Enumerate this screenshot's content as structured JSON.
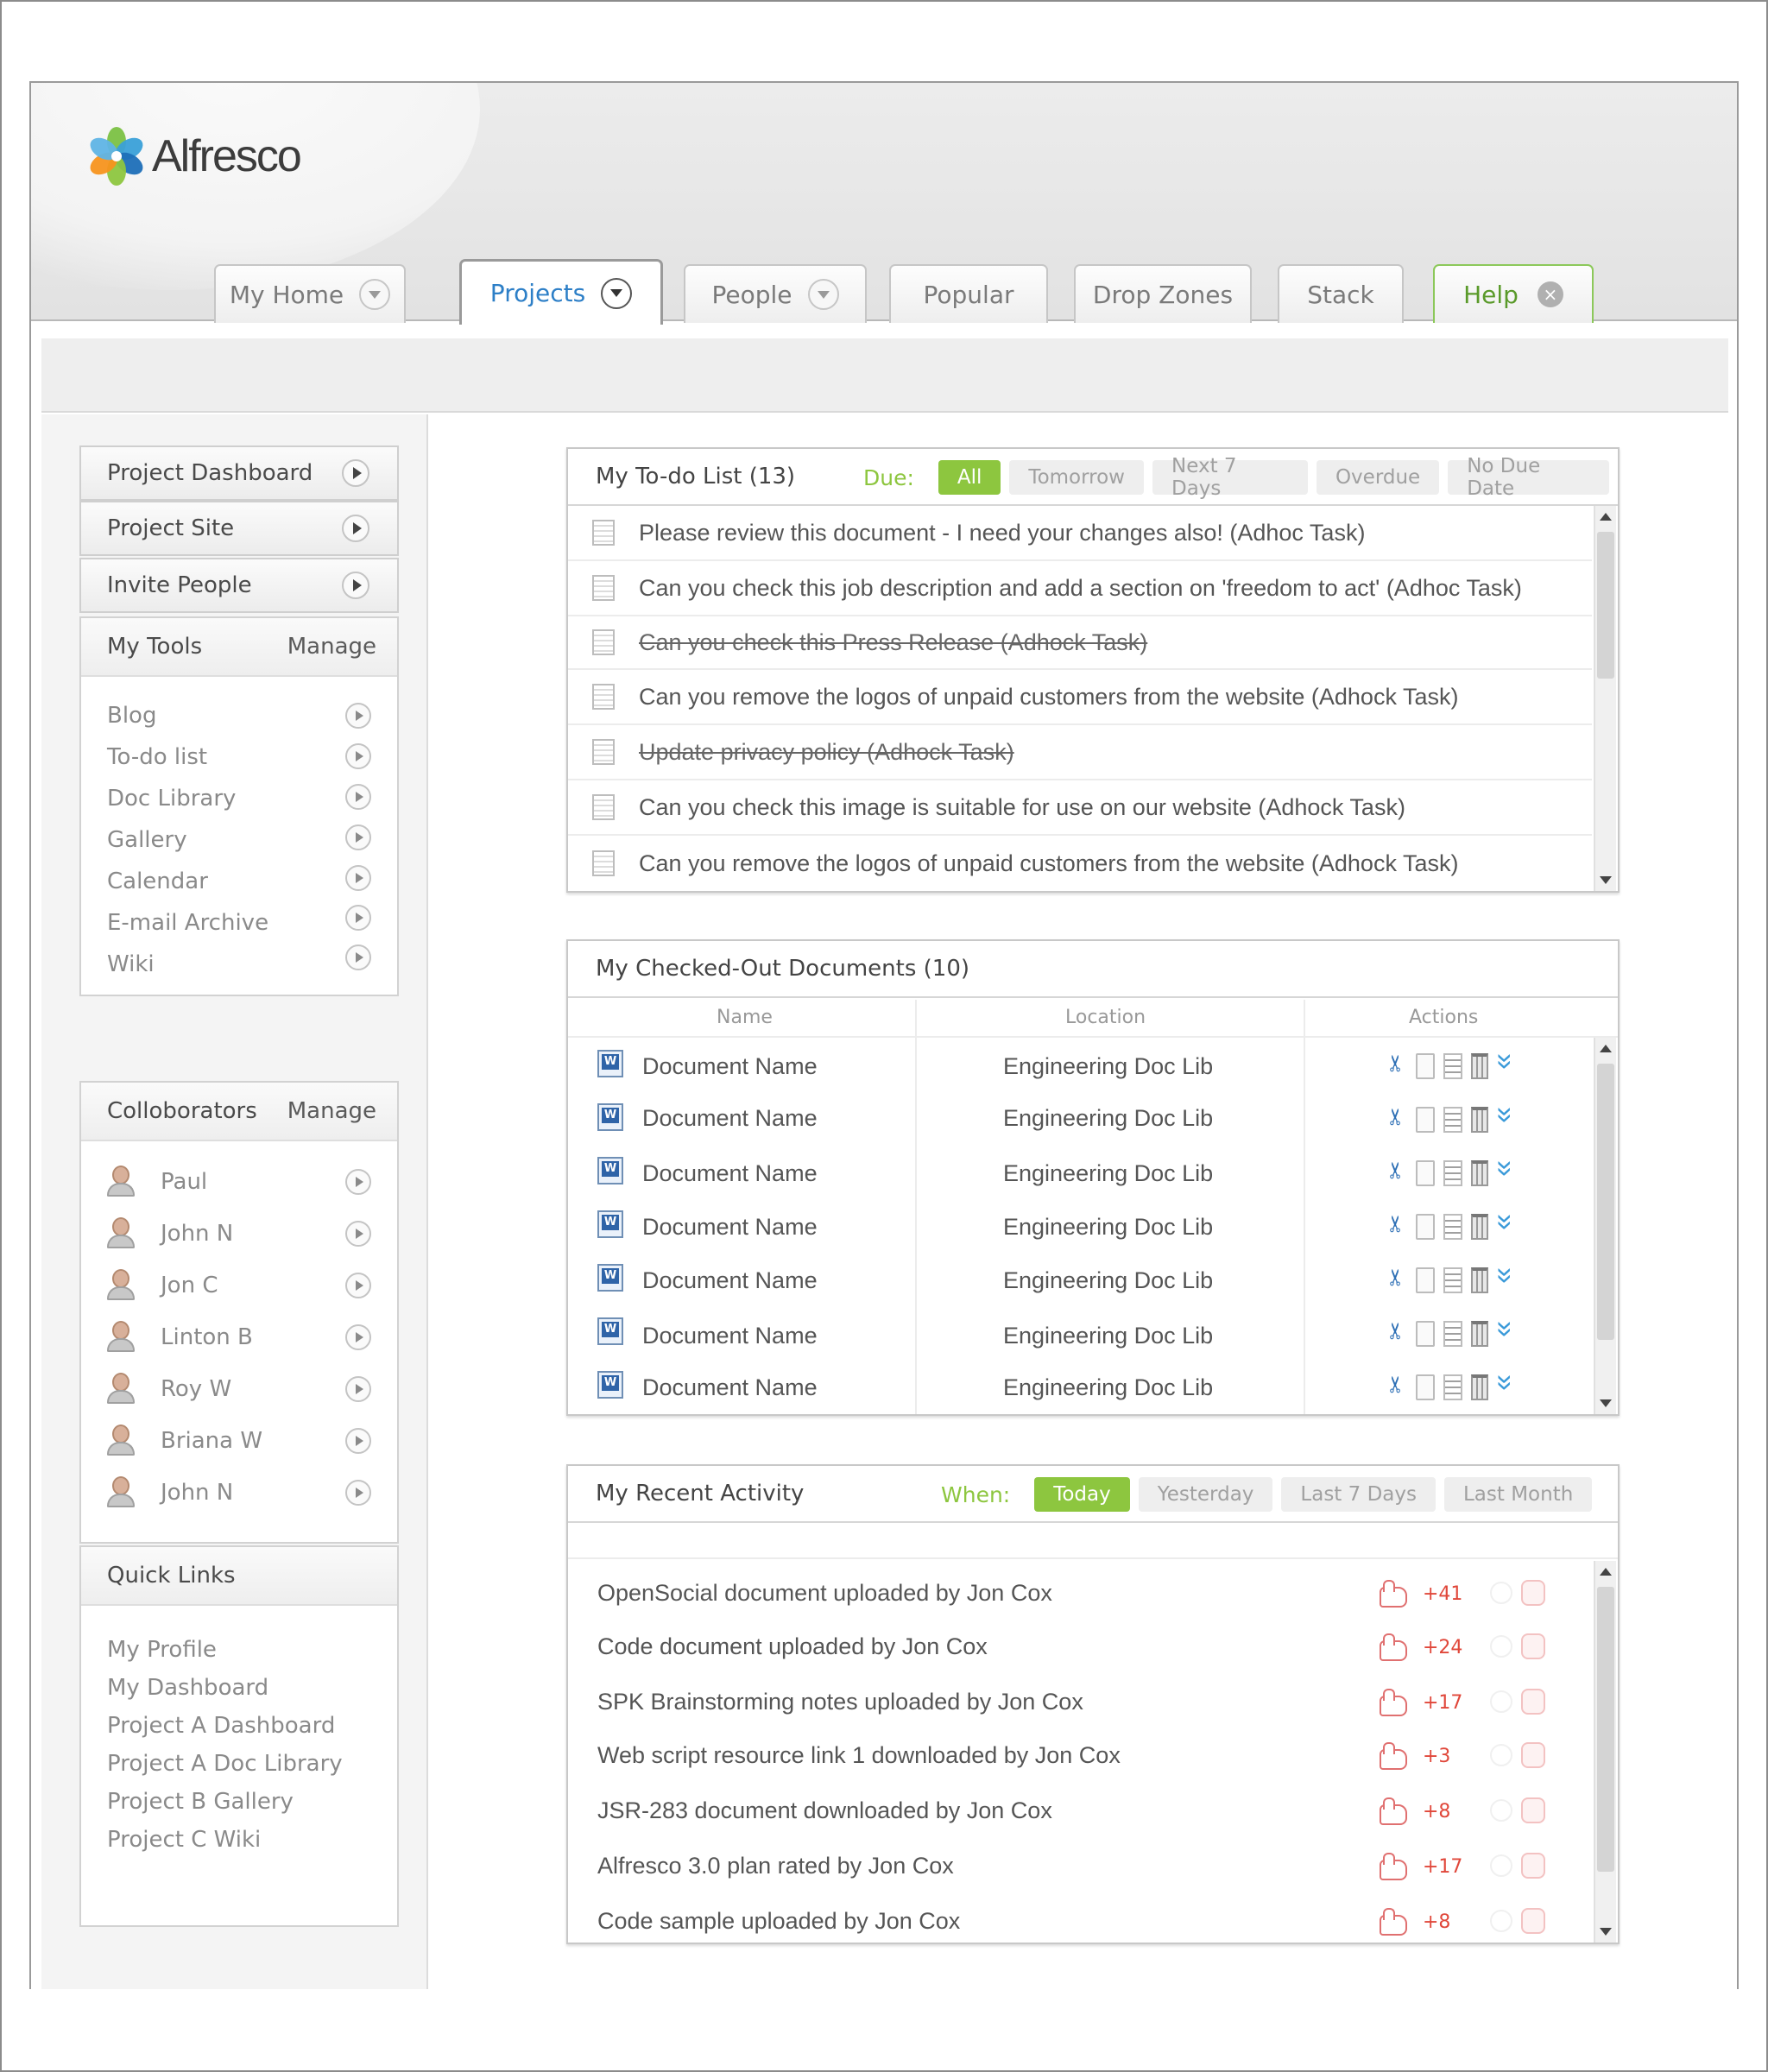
{
  "app": {
    "logo_text": "Alfresco"
  },
  "tabs": [
    {
      "label": "My Home",
      "has_dropdown": true
    },
    {
      "label": "Projects",
      "has_dropdown": true,
      "active": true
    },
    {
      "label": "People",
      "has_dropdown": true
    },
    {
      "label": "Popular"
    },
    {
      "label": "Drop Zones"
    },
    {
      "label": "Stack"
    },
    {
      "label": "Help",
      "has_close": true
    }
  ],
  "sidebar": {
    "nav": [
      {
        "label": "Project Dashboard"
      },
      {
        "label": "Project Site"
      },
      {
        "label": "Invite People"
      }
    ],
    "tools": {
      "title": "My Tools",
      "manage": "Manage",
      "items": [
        "Blog",
        "To-do list",
        "Doc Library",
        "Gallery",
        "Calendar",
        "E-mail Archive",
        "Wiki"
      ]
    },
    "collaborators": {
      "title": "Colloborators",
      "manage": "Manage",
      "items": [
        "Paul",
        "John N",
        "Jon C",
        "Linton B",
        "Roy W",
        "Briana W",
        "John N"
      ]
    },
    "quick_links": {
      "title": "Quick Links",
      "items": [
        "My Profile",
        "My Dashboard",
        "Project A Dashboard",
        "Project A Doc Library",
        "Project B Gallery",
        "Project C Wiki"
      ]
    }
  },
  "todo": {
    "title": "My To-do List (13)",
    "filter_label": "Due:",
    "filters": [
      "All",
      "Tomorrow",
      "Next 7 Days",
      "Overdue",
      "No Due Date"
    ],
    "active_filter": "All",
    "items": [
      {
        "text": "Please review this document - I need your changes also! (Adhoc Task)",
        "done": false
      },
      {
        "text": "Can you check this job description and add a section on 'freedom to act' (Adhoc Task)",
        "done": false
      },
      {
        "text": "Can you check this Press Release (Adhock Task)",
        "done": true
      },
      {
        "text": "Can you remove the logos of unpaid customers from the website (Adhock Task)",
        "done": false
      },
      {
        "text": "Update privacy policy (Adhock Task)",
        "done": true
      },
      {
        "text": "Can you check this image is suitable for use on our website (Adhock Task)",
        "done": false
      },
      {
        "text": "Can you remove the logos of unpaid customers from the website (Adhock Task)",
        "done": false
      }
    ]
  },
  "checked_out": {
    "title": "My Checked-Out Documents (10)",
    "columns": [
      "Name",
      "Location",
      "Actions"
    ],
    "rows": [
      {
        "name": "Document Name",
        "location": "Engineering Doc Lib"
      },
      {
        "name": "Document Name",
        "location": "Engineering Doc Lib"
      },
      {
        "name": "Document Name",
        "location": "Engineering Doc Lib"
      },
      {
        "name": "Document Name",
        "location": "Engineering Doc Lib"
      },
      {
        "name": "Document Name",
        "location": "Engineering Doc Lib"
      },
      {
        "name": "Document Name",
        "location": "Engineering Doc Lib"
      },
      {
        "name": "Document Name",
        "location": "Engineering Doc Lib"
      }
    ],
    "action_icons": [
      "cut-icon",
      "copy-icon",
      "properties-icon",
      "delete-icon",
      "more-icon"
    ]
  },
  "activity": {
    "title": "My Recent Activity",
    "filter_label": "When:",
    "filters": [
      "Today",
      "Yesterday",
      "Last 7 Days",
      "Last Month"
    ],
    "active_filter": "Today",
    "items": [
      {
        "text": "OpenSocial document uploaded by Jon Cox",
        "score": "+41"
      },
      {
        "text": "Code document uploaded by Jon Cox",
        "score": "+24"
      },
      {
        "text": "SPK Brainstorming notes uploaded by Jon Cox",
        "score": "+17"
      },
      {
        "text": "Web script resource link 1 downloaded by Jon Cox",
        "score": "+3"
      },
      {
        "text": "JSR-283 document downloaded by Jon Cox",
        "score": "+8"
      },
      {
        "text": "Alfresco 3.0 plan rated by Jon Cox",
        "score": "+17"
      },
      {
        "text": "Code sample uploaded by Jon Cox",
        "score": "+8"
      }
    ]
  },
  "colors": {
    "accent_green": "#8dc63f",
    "active_tab_text": "#2d7fc7",
    "score_red": "#e0473a"
  }
}
